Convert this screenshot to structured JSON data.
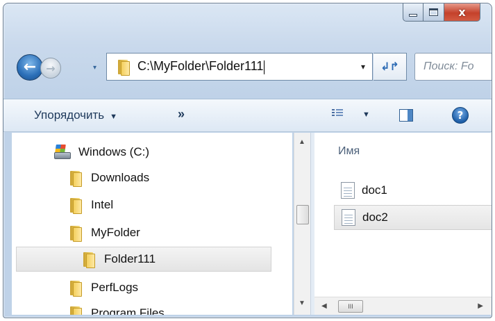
{
  "window": {
    "controls": {
      "minimize_icon": "minimize-icon",
      "maximize_icon": "maximize-icon",
      "close_glyph": "x"
    }
  },
  "nav": {
    "back_glyph": "←",
    "forward_glyph": "→",
    "recent_dropdown_glyph": "▾",
    "address_path": "C:\\MyFolder\\Folder111",
    "address_dropdown_glyph": "▾",
    "refresh_glyph": "↲↱",
    "search_placeholder": "Поиск: Fo"
  },
  "toolbar": {
    "organize_label": "Упорядочить",
    "organize_dropdown": "▼",
    "more_label": "»",
    "views_dropdown": "▼",
    "help_glyph": "?"
  },
  "navpane": {
    "items": [
      {
        "label": "Windows (C:)",
        "icon": "drive-icon"
      },
      {
        "label": "Downloads",
        "icon": "folder-icon"
      },
      {
        "label": "Intel",
        "icon": "folder-icon"
      },
      {
        "label": "MyFolder",
        "icon": "folder-icon"
      },
      {
        "label": "Folder111",
        "icon": "folder-icon",
        "selected": true
      },
      {
        "label": "PerfLogs",
        "icon": "folder-icon"
      },
      {
        "label": "Program Files",
        "icon": "folder-icon"
      }
    ],
    "scroll_up": "▲",
    "scroll_down": "▼"
  },
  "content": {
    "column_name": "Имя",
    "files": [
      {
        "name": "doc1",
        "icon": "text-document-icon"
      },
      {
        "name": "doc2",
        "icon": "text-document-icon",
        "selected": true
      }
    ],
    "hscroll_left": "◀",
    "hscroll_right": "▶",
    "hscroll_grip": "III"
  },
  "colors": {
    "frame": "#c9d9ec",
    "close_button": "#c4412b",
    "selection": "#e5e5e5",
    "accent": "#2b6fb8"
  }
}
